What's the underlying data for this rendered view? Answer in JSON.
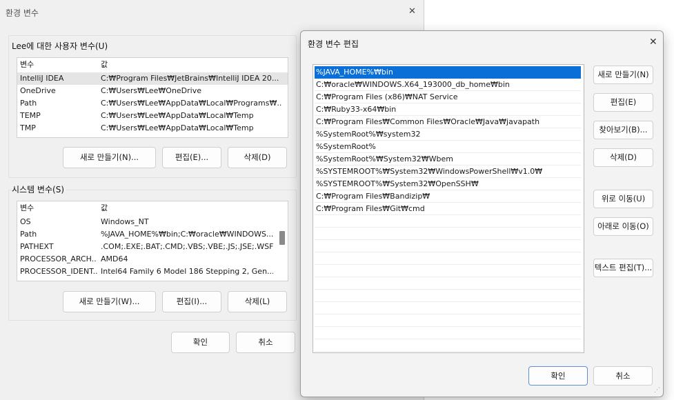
{
  "env_window": {
    "title": "환경 변수",
    "close_glyph": "✕",
    "user_group": {
      "label": "Lee에 대한 사용자 변수(U)",
      "col_var": "변수",
      "col_val": "값",
      "rows": [
        {
          "name": "IntelliJ IDEA",
          "value": "C:₩Program Files₩JetBrains₩IntelliJ IDEA 20..."
        },
        {
          "name": "OneDrive",
          "value": "C:₩Users₩Lee₩OneDrive"
        },
        {
          "name": "Path",
          "value": "C:₩Users₩Lee₩AppData₩Local₩Programs₩..."
        },
        {
          "name": "TEMP",
          "value": "C:₩Users₩Lee₩AppData₩Local₩Temp"
        },
        {
          "name": "TMP",
          "value": "C:₩Users₩Lee₩AppData₩Local₩Temp"
        }
      ],
      "new_label": "새로 만들기(N)...",
      "edit_label": "편집(E)...",
      "delete_label": "삭제(D)"
    },
    "system_group": {
      "label": "시스템 변수(S)",
      "col_var": "변수",
      "col_val": "값",
      "rows": [
        {
          "name": "OS",
          "value": "Windows_NT"
        },
        {
          "name": "Path",
          "value": "%JAVA_HOME%₩bin;C:₩oracle₩WINDOWS...."
        },
        {
          "name": "PATHEXT",
          "value": ".COM;.EXE;.BAT;.CMD;.VBS;.VBE;.JS;.JSE;.WSF;..."
        },
        {
          "name": "PROCESSOR_ARCH...",
          "value": "AMD64"
        },
        {
          "name": "PROCESSOR_IDENT...",
          "value": "Intel64 Family 6 Model 186 Stepping 2, Gen..."
        }
      ],
      "new_label": "새로 만들기(W)...",
      "edit_label": "편집(I)...",
      "delete_label": "삭제(L)"
    },
    "ok_label": "확인",
    "cancel_label": "취소"
  },
  "edit_window": {
    "title": "환경 변수 편집",
    "close_glyph": "✕",
    "entries": [
      "%JAVA_HOME%₩bin",
      "C:₩oracle₩WINDOWS.X64_193000_db_home₩bin",
      "C:₩Program Files (x86)₩NAT Service",
      "C:₩Ruby33-x64₩bin",
      "C:₩Program Files₩Common Files₩Oracle₩Java₩javapath",
      "%SystemRoot%₩system32",
      "%SystemRoot%",
      "%SystemRoot%₩System32₩Wbem",
      "%SYSTEMROOT%₩System32₩WindowsPowerShell₩v1.0₩",
      "%SYSTEMROOT%₩System32₩OpenSSH₩",
      "C:₩Program Files₩Bandizip₩",
      "C:₩Program Files₩Git₩cmd"
    ],
    "new_label": "새로 만들기(N)",
    "edit_label": "편집(E)",
    "browse_label": "찾아보기(B)...",
    "delete_label": "삭제(D)",
    "up_label": "위로 이동(U)",
    "down_label": "아래로 이동(O)",
    "text_edit_label": "텍스트 편집(T)...",
    "ok_label": "확인",
    "cancel_label": "취소",
    "grip_glyph": "⋰"
  }
}
